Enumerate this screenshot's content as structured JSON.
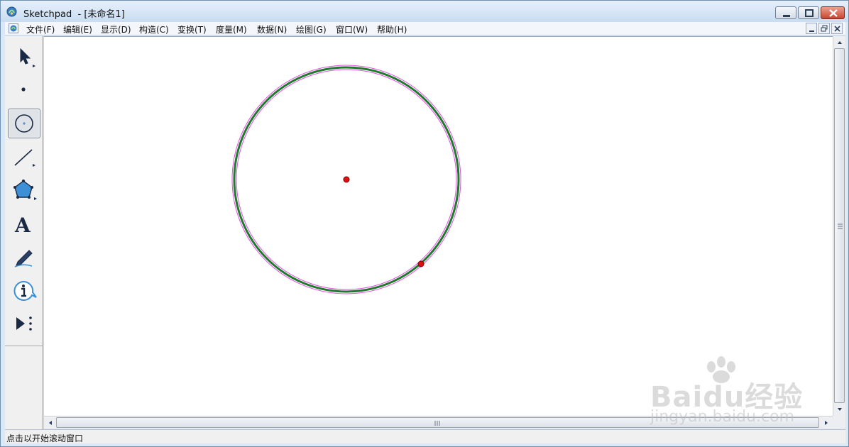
{
  "window": {
    "app_name": "Sketchpad",
    "title": "Sketchpad  - [未命名1]"
  },
  "menu": {
    "items": [
      "文件(F)",
      "编辑(E)",
      "显示(D)",
      "构造(C)",
      "变换(T)",
      "度量(M)",
      "数据(N)",
      "绘图(G)",
      "窗口(W)",
      "帮助(H)"
    ]
  },
  "toolbox": {
    "tools": [
      "arrow-select-tool",
      "point-tool",
      "compass-tool",
      "straightedge-tool",
      "polygon-tool",
      "text-tool",
      "marker-tool",
      "information-tool",
      "custom-tool"
    ],
    "text_tool_glyph": "A",
    "selected": "compass-tool"
  },
  "canvas": {
    "objects": [
      {
        "type": "circle",
        "color": "#1f7a2e",
        "highlight": "#e04de0",
        "selected": true
      },
      {
        "type": "point",
        "role": "center",
        "color": "#e01010"
      },
      {
        "type": "point",
        "role": "on-circle",
        "color": "#e01010"
      }
    ]
  },
  "status": {
    "text": "点击以开始滚动窗口"
  },
  "watermark": {
    "logo": "Baidu经验",
    "url": "jingyan.baidu.com"
  },
  "colors": {
    "titlebar": "#c9dcf1",
    "circle": "#1f7a2e",
    "point": "#e01010",
    "selection": "#e04de0"
  }
}
